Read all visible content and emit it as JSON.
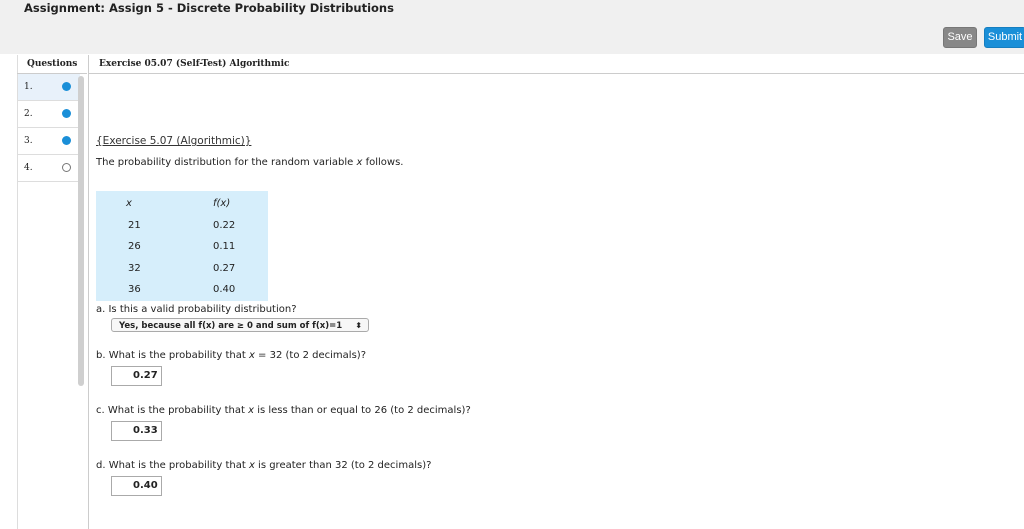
{
  "header": {
    "assignment_title": "Assignment: Assign 5 - Discrete Probability Distributions",
    "save_label": "Save",
    "submit_label": "Submit"
  },
  "sidebar": {
    "header": "Questions",
    "items": [
      {
        "label": "1.",
        "status": "answered"
      },
      {
        "label": "2.",
        "status": "answered"
      },
      {
        "label": "3.",
        "status": "answered"
      },
      {
        "label": "4.",
        "status": "unanswered"
      }
    ]
  },
  "exercise": {
    "header": "Exercise 05.07 (Self-Test) Algorithmic",
    "link_text": "{Exercise 5.07 (Algorithmic)}",
    "intro_pre": "The probability distribution for the random variable ",
    "intro_var": "x",
    "intro_post": " follows.",
    "table": {
      "headers": [
        "x",
        "f(x)"
      ],
      "rows": [
        [
          "21",
          "0.22"
        ],
        [
          "26",
          "0.11"
        ],
        [
          "32",
          "0.27"
        ],
        [
          "36",
          "0.40"
        ]
      ]
    },
    "part_a": {
      "question": "a. Is this a valid probability distribution?",
      "selected": "Yes, because all f(x) are ≥ 0 and sum of f(x)=1",
      "arrow": "⬍"
    },
    "part_b": {
      "q_pre": "b. What is the probability that ",
      "q_var": "x",
      "q_post": " = 32 (to 2 decimals)?",
      "answer": "0.27"
    },
    "part_c": {
      "q_pre": "c. What is the probability that ",
      "q_var": "x",
      "q_post": " is less than or equal to 26 (to 2 decimals)?",
      "answer": "0.33"
    },
    "part_d": {
      "q_pre": "d. What is the probability that ",
      "q_var": "x",
      "q_post": " is greater than 32 (to 2 decimals)?",
      "answer": "0.40"
    }
  },
  "colors": {
    "accent": "#1a8fd8",
    "table_bg": "#d6eefb",
    "save_bg": "#888888"
  }
}
